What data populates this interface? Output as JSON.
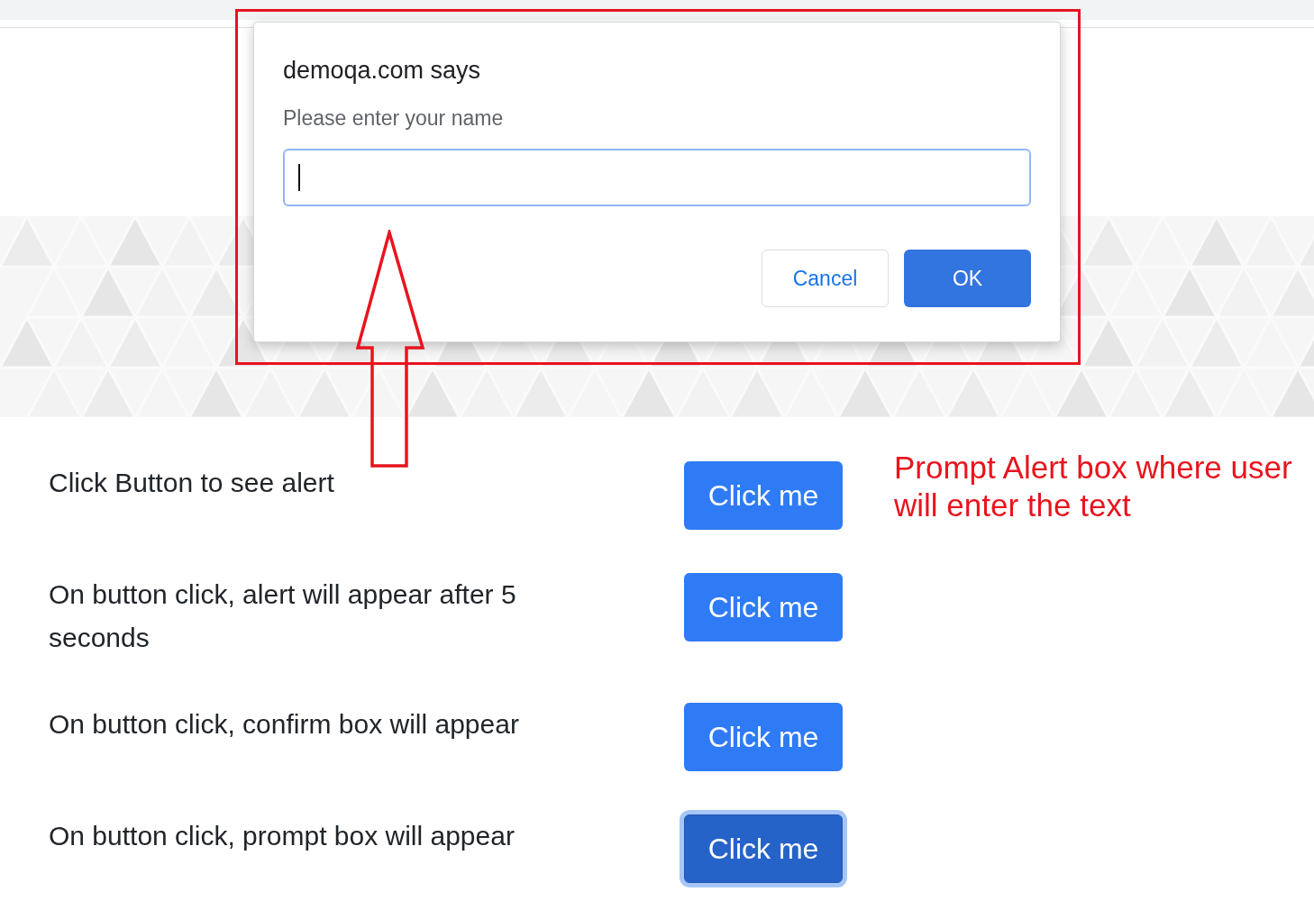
{
  "dialog": {
    "title": "demoqa.com says",
    "message": "Please enter your name",
    "input": {
      "focused": true
    },
    "buttons": [
      {
        "label": "Cancel",
        "kind": "secondary"
      },
      {
        "label": "OK",
        "kind": "primary"
      }
    ]
  },
  "rows": [
    {
      "text": "Click Button to see alert",
      "button": "Click me",
      "focused": false
    },
    {
      "text": "On button click, alert will appear after 5 seconds",
      "button": "Click me",
      "focused": false
    },
    {
      "text": "On button click, confirm box will appear",
      "button": "Click me",
      "focused": false
    },
    {
      "text": "On button click, prompt box will appear",
      "button": "Click me",
      "focused": true
    }
  ],
  "annotation": {
    "text": "Prompt Alert box where user will enter the text"
  }
}
